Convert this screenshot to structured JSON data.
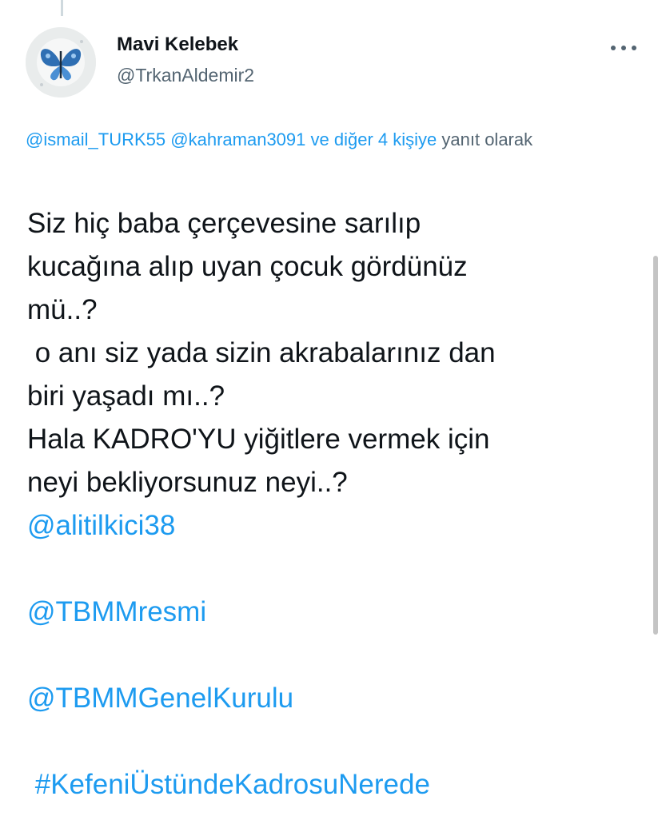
{
  "author": {
    "display_name": "Mavi Kelebek",
    "handle": "@TrkanAldemir2",
    "avatar_icon": "butterfly-icon"
  },
  "actions": {
    "more_icon": "more-horizontal-icon"
  },
  "reply_context": {
    "mention_1": "@ismail_TURK55",
    "mention_2": "@kahraman3091",
    "others": "ve diğer 4 kişiye",
    "suffix": "yanıt olarak"
  },
  "tweet": {
    "lines": [
      "Siz hiç baba çerçevesine sarılıp",
      "kucağına alıp uyan çocuk gördünüz",
      "mü..?",
      " o anı siz yada sizin akrabalarınız dan",
      "biri yaşadı mı..?",
      "Hala KADRO'YU yiğitlere vermek için",
      "neyi bekliyorsunuz neyi..?"
    ],
    "mentions": [
      "@alitilkici38",
      "@TBMMresmi",
      "@TBMMGenelKurulu"
    ],
    "hashtag": " #KefeniÜstündeKadrosuNerede"
  },
  "colors": {
    "link": "#1d9bf0",
    "text": "#0f1419",
    "secondary": "#536471"
  }
}
